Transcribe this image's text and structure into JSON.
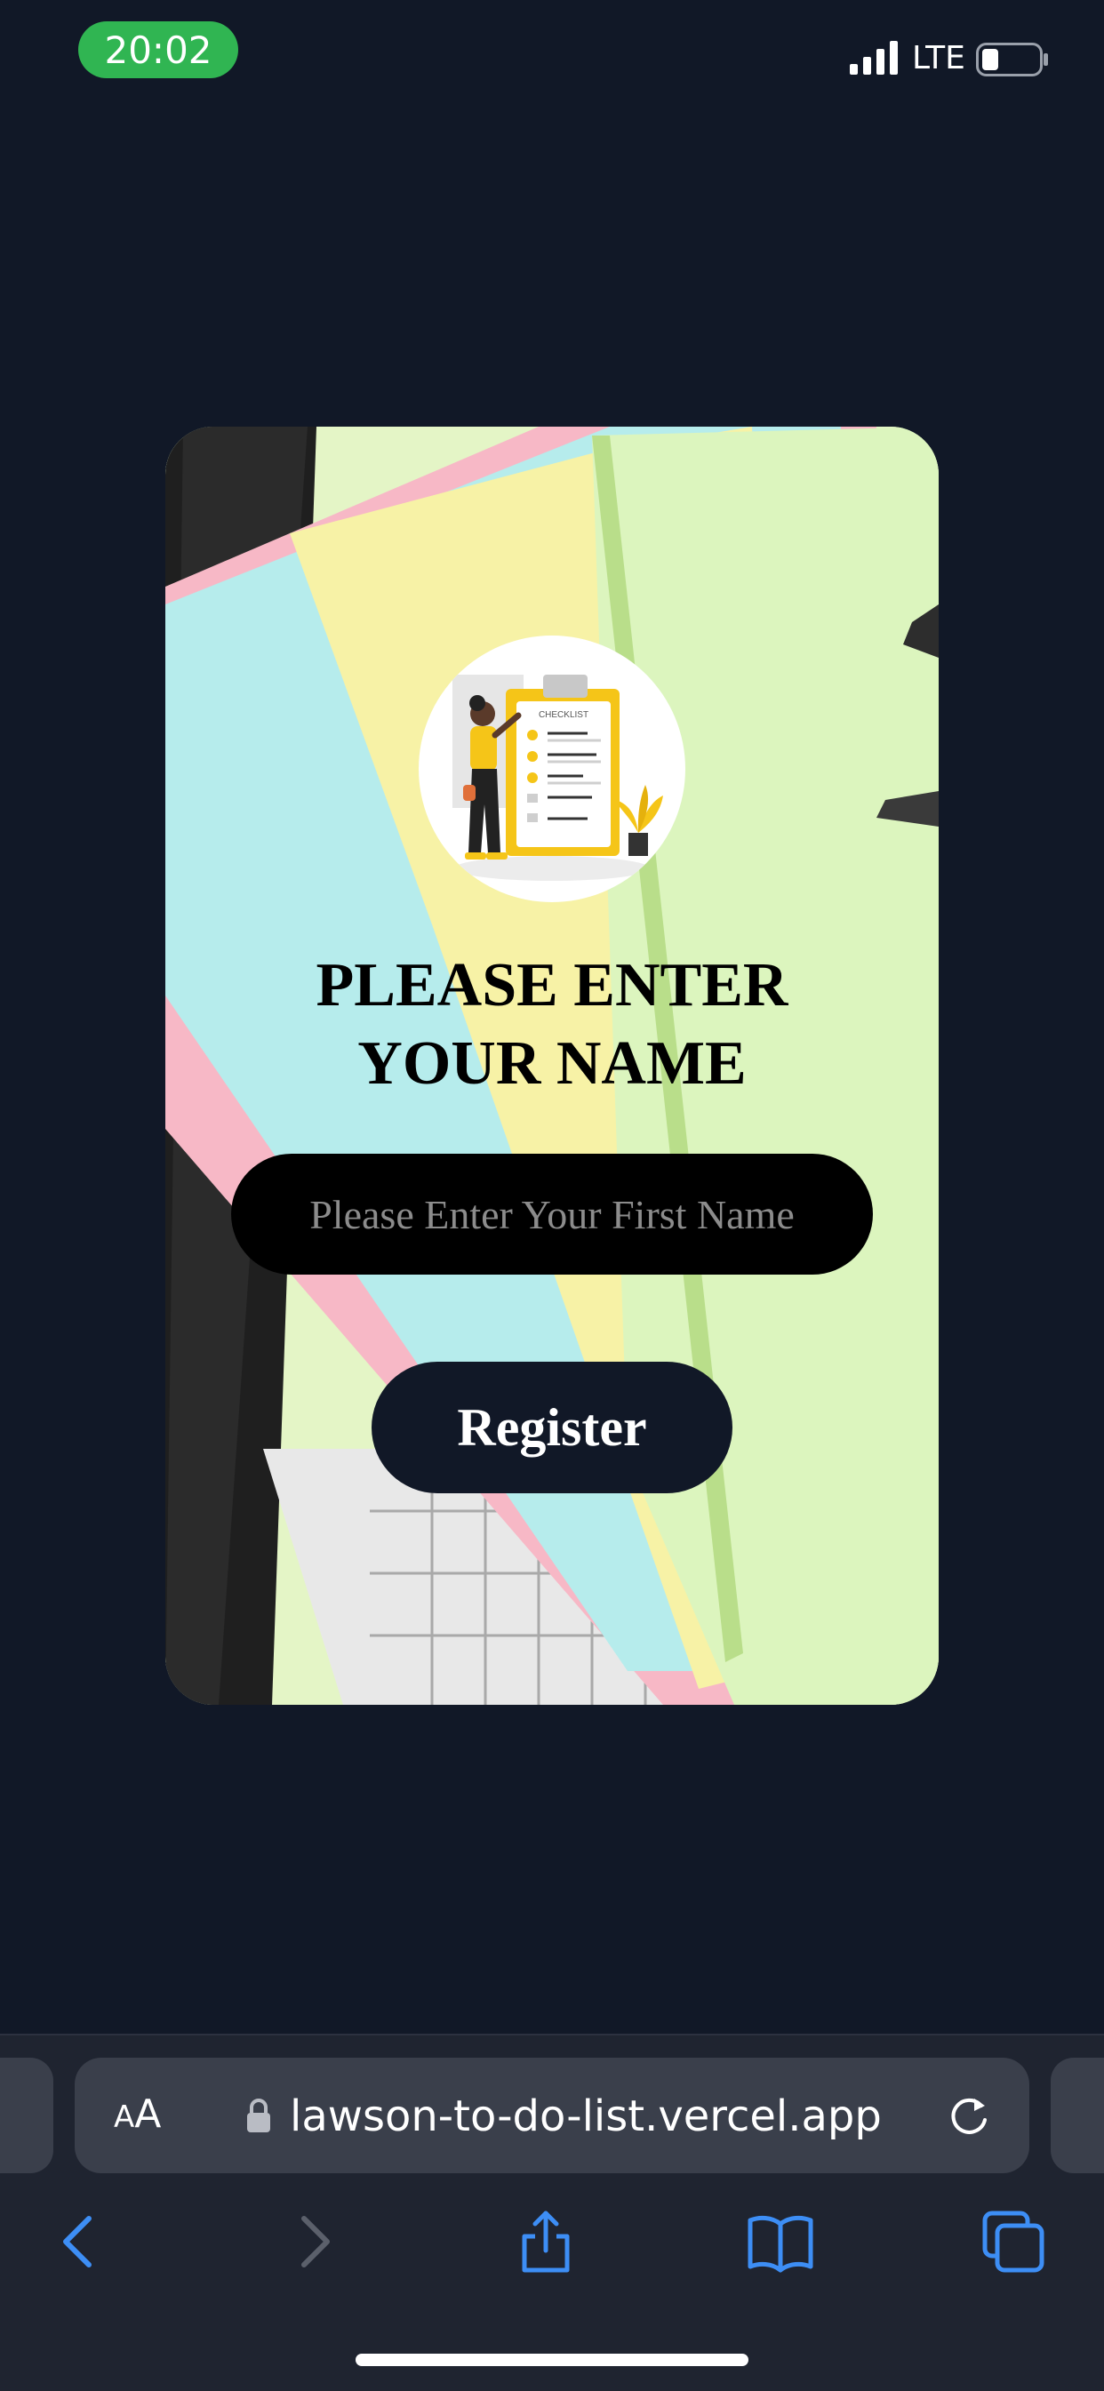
{
  "status_bar": {
    "time": "20:02",
    "network": "LTE",
    "icons": [
      "signal-icon",
      "battery-icon"
    ]
  },
  "card": {
    "illustration": {
      "label": "CHECKLIST",
      "icon": "checklist-illustration"
    },
    "heading": {
      "line1": "PLEASE ENTER",
      "line2": "YOUR NAME"
    },
    "name_input": {
      "placeholder": "Please Enter Your First Name",
      "value": ""
    },
    "register_label": "Register"
  },
  "browser": {
    "aa_label_small": "A",
    "aa_label_large": "A",
    "url": "lawson-to-do-list.vercel.app",
    "toolbar": [
      "back-icon",
      "forward-icon",
      "share-icon",
      "bookmarks-icon",
      "tabs-icon"
    ],
    "accent_color": "#3d8ef5"
  }
}
